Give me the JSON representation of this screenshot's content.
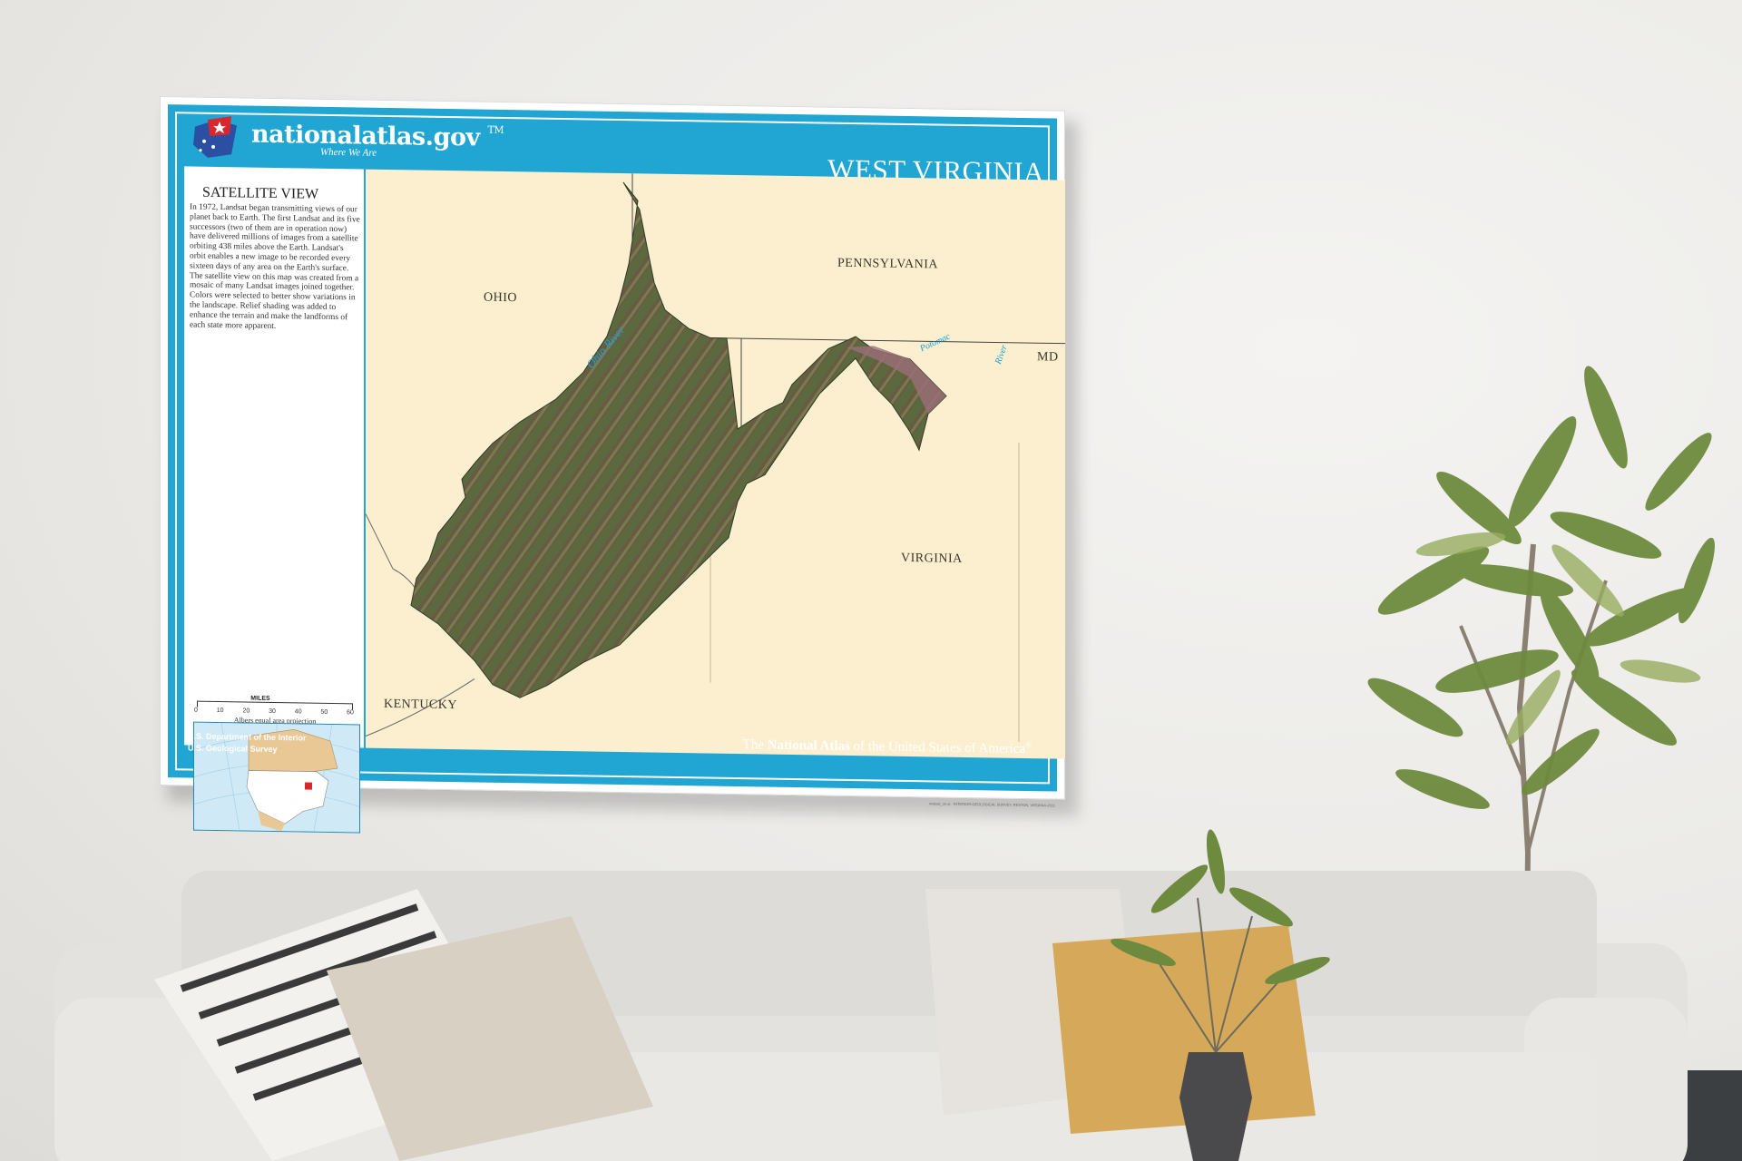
{
  "poster": {
    "brand": "nationalatlas.gov",
    "brand_tm": "TM",
    "tagline": "Where We Are",
    "state_title": "WEST VIRGINIA",
    "panel_title": "SATELLITE VIEW",
    "panel_text": "In 1972, Landsat began transmitting views of our planet back to Earth. The first Landsat and its five successors (two of them are in operation now) have delivered millions of images from a satellite orbiting 438 miles above the Earth. Landsat's orbit enables a new image to be recorded every sixteen days of any area on the Earth's surface. The satellite view on this map was created from a mosaic of many Landsat images joined together. Colors were selected to better show variations in the landscape. Relief shading was added to enhance the terrain and make the landforms of each state more apparent.",
    "scale_label": "MILES",
    "scale_ticks": [
      "0",
      "10",
      "20",
      "30",
      "40",
      "50",
      "60"
    ],
    "projection": "Albers equal area projection",
    "dept_line1": "U.S. Department of the Interior",
    "dept_line2": "U.S. Geological Survey",
    "footer_pre": "The ",
    "footer_bold": "National Atlas",
    "footer_post": " of the United States of America",
    "footer_reg": "®",
    "credit": "wvpsat_on.ai · INTERIOR-GEOLOGICAL SURVEY, RESTON, VIRGINIA-2011"
  },
  "map_labels": {
    "ohio": "OHIO",
    "pennsylvania": "PENNSYLVANIA",
    "md": "MD",
    "virginia": "VIRGINIA",
    "kentucky": "KENTUCKY",
    "ohio_river": "Ohio River",
    "potomac": "Potomac",
    "river": "River"
  },
  "colors": {
    "frame_blue": "#21a6d4",
    "map_beige": "#fbefcf",
    "terrain_green": "#4f6a3c",
    "terrain_brown": "#7d6348"
  }
}
